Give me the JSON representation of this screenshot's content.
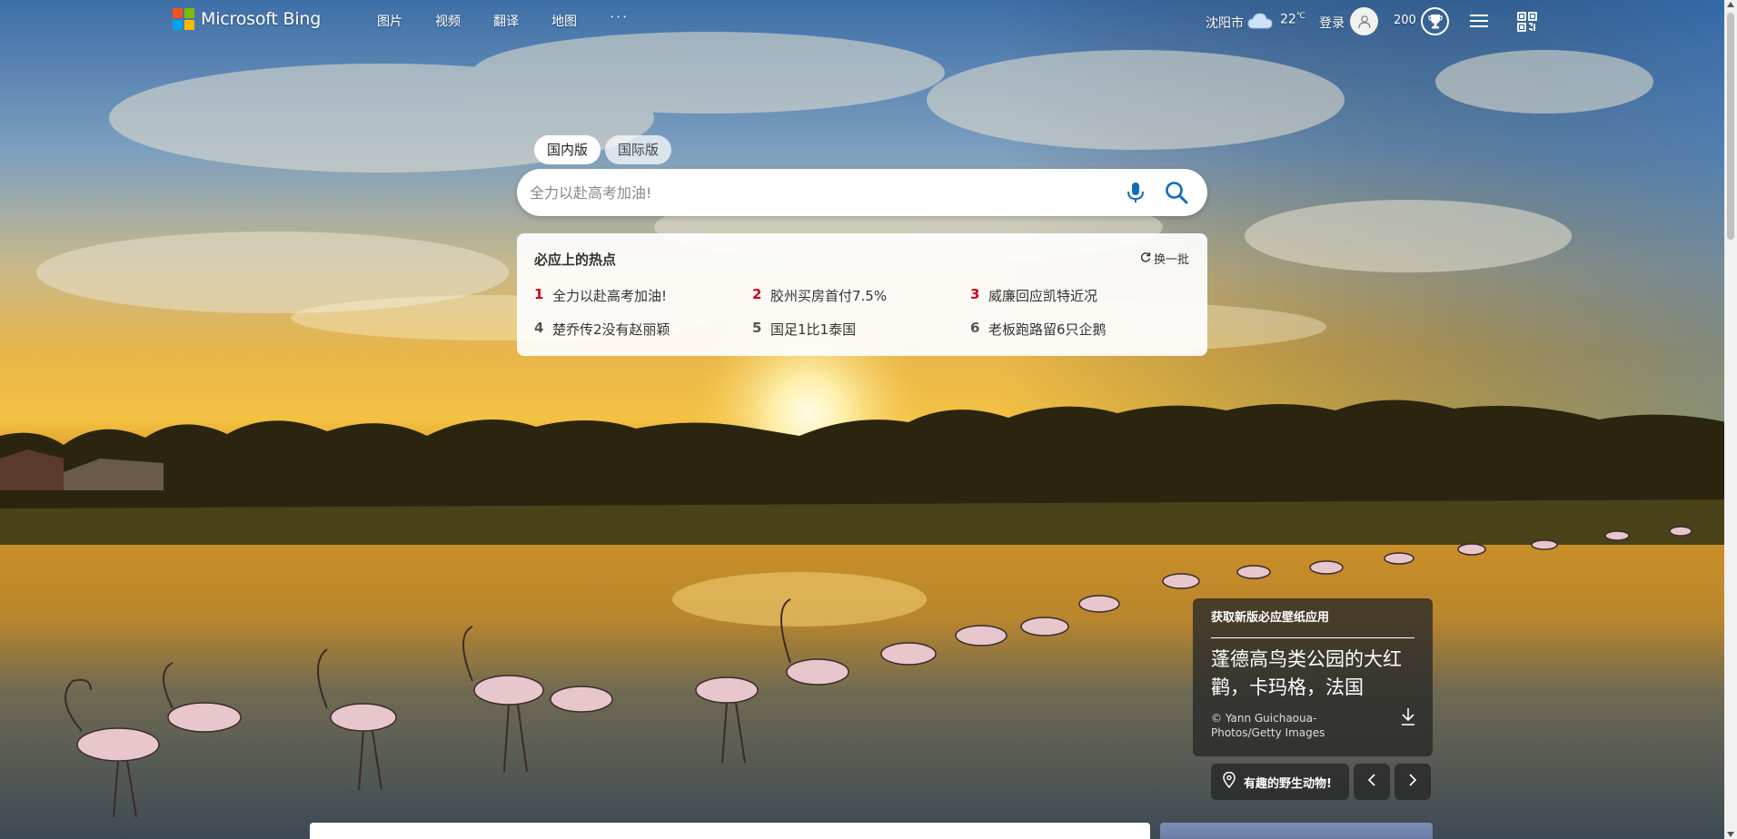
{
  "header": {
    "brand": "Microsoft Bing",
    "logo_colors": [
      "#f25022",
      "#7fba00",
      "#00a4ef",
      "#ffb900"
    ],
    "nav": [
      {
        "label": "图片"
      },
      {
        "label": "视频"
      },
      {
        "label": "翻译"
      },
      {
        "label": "地图"
      }
    ],
    "more_label": "···",
    "city": "沈阳市",
    "temperature": "22",
    "temp_unit": "℃",
    "signin_label": "登录",
    "points": "200"
  },
  "search": {
    "tabs": [
      {
        "label": "国内版",
        "active": true
      },
      {
        "label": "国际版",
        "active": false
      }
    ],
    "placeholder": "全力以赴高考加油!"
  },
  "hot": {
    "title": "必应上的热点",
    "refresh_label": "换一批",
    "items": [
      {
        "num": "1",
        "text": "全力以赴高考加油!"
      },
      {
        "num": "2",
        "text": "胶州买房首付7.5%"
      },
      {
        "num": "3",
        "text": "威廉回应凯特近况"
      },
      {
        "num": "4",
        "text": "楚乔传2没有赵丽颖"
      },
      {
        "num": "5",
        "text": "国足1比1泰国"
      },
      {
        "num": "6",
        "text": "老板跑路留6只企鹅"
      }
    ]
  },
  "card": {
    "top_label": "获取新版必应壁纸应用",
    "title": "蓬德高鸟类公园的大红鹳，卡玛格，法国",
    "credit": "© Yann Guichaoua-Photos/Getty Images"
  },
  "location_pill": "有趣的野生动物!",
  "icons": {
    "weather": "cloud-icon",
    "avatar": "user-icon",
    "rewards": "trophy-icon",
    "menu": "hamburger-icon",
    "qr": "qr-code-icon",
    "mic": "microphone-icon",
    "search": "search-icon",
    "refresh": "refresh-icon",
    "download": "download-icon",
    "location": "location-pin-icon"
  },
  "colors": {
    "accent_blue": "#0078d4",
    "hot_red": "#d0021b"
  }
}
